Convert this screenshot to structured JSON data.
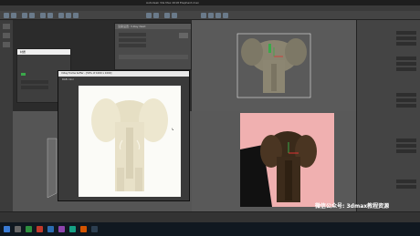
{
  "app": {
    "title": "Autodesk 3ds Max 2018    Elephant.max"
  },
  "render_settings": {
    "title": "渲染设置: V-Ray Next"
  },
  "material_dialog": {
    "title": "材质"
  },
  "vfb": {
    "title": "V-Ray frame buffer - [50% of 1000 x 1000]",
    "channel": "RGB color"
  },
  "watermark": {
    "text": "微信公众号: 3dmax教程资源"
  },
  "colors": {
    "accent_green": "#3aa84a",
    "render_bg_pink": "#f0b0b0",
    "taskbar": "#101820"
  }
}
